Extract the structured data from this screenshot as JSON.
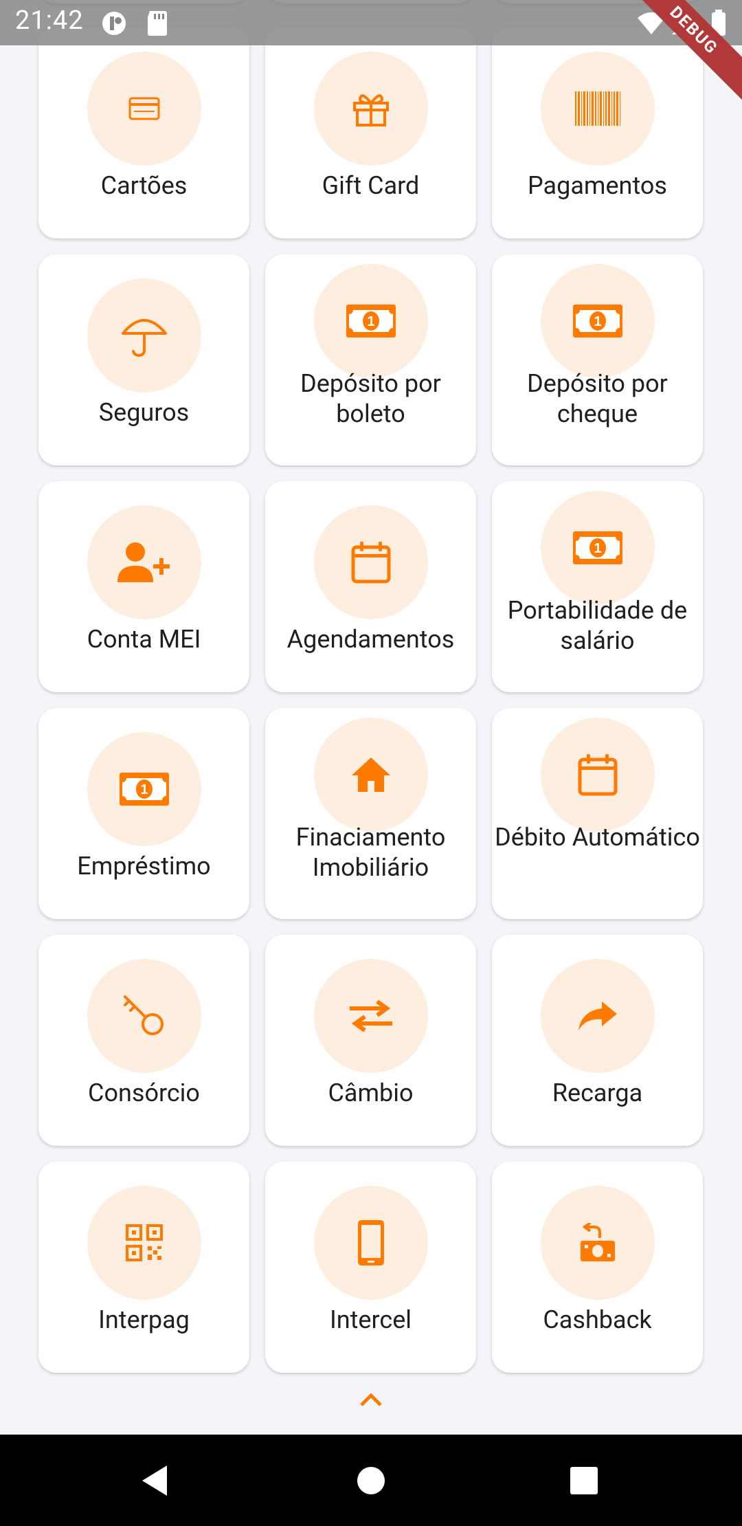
{
  "status_bar": {
    "time": "21:42",
    "debug_label": "DEBUG"
  },
  "colors": {
    "accent": "#ff7a00",
    "circle_bg": "#fdeee0",
    "card_bg": "#ffffff",
    "page_bg": "#f4f5f9"
  },
  "tiles": [
    {
      "label": "Cartões",
      "icon": "credit-card-icon"
    },
    {
      "label": "Gift Card",
      "icon": "gift-icon"
    },
    {
      "label": "Pagamentos",
      "icon": "barcode-icon"
    },
    {
      "label": "Seguros",
      "icon": "umbrella-icon"
    },
    {
      "label": "Depósito por boleto",
      "icon": "banknote-icon"
    },
    {
      "label": "Depósito por cheque",
      "icon": "banknote-icon"
    },
    {
      "label": "Conta MEI",
      "icon": "add-user-icon"
    },
    {
      "label": "Agendamentos",
      "icon": "calendar-icon"
    },
    {
      "label": "Portabilidade de salário",
      "icon": "banknote-icon"
    },
    {
      "label": "Empréstimo",
      "icon": "banknote-icon"
    },
    {
      "label": "Finaciamento Imobiliário",
      "icon": "home-icon"
    },
    {
      "label": "Débito Automático",
      "icon": "calendar-icon"
    },
    {
      "label": "Consórcio",
      "icon": "key-icon"
    },
    {
      "label": "Câmbio",
      "icon": "exchange-icon"
    },
    {
      "label": "Recarga",
      "icon": "share-arrow-icon"
    },
    {
      "label": "Interpag",
      "icon": "qr-code-icon"
    },
    {
      "label": "Intercel",
      "icon": "phone-icon"
    },
    {
      "label": "Cashback",
      "icon": "cashback-icon"
    }
  ],
  "collapse_icon": "chevron-up-icon",
  "nav_bar": {
    "back": "back-icon",
    "home": "home-circle-icon",
    "recents": "recents-icon"
  }
}
